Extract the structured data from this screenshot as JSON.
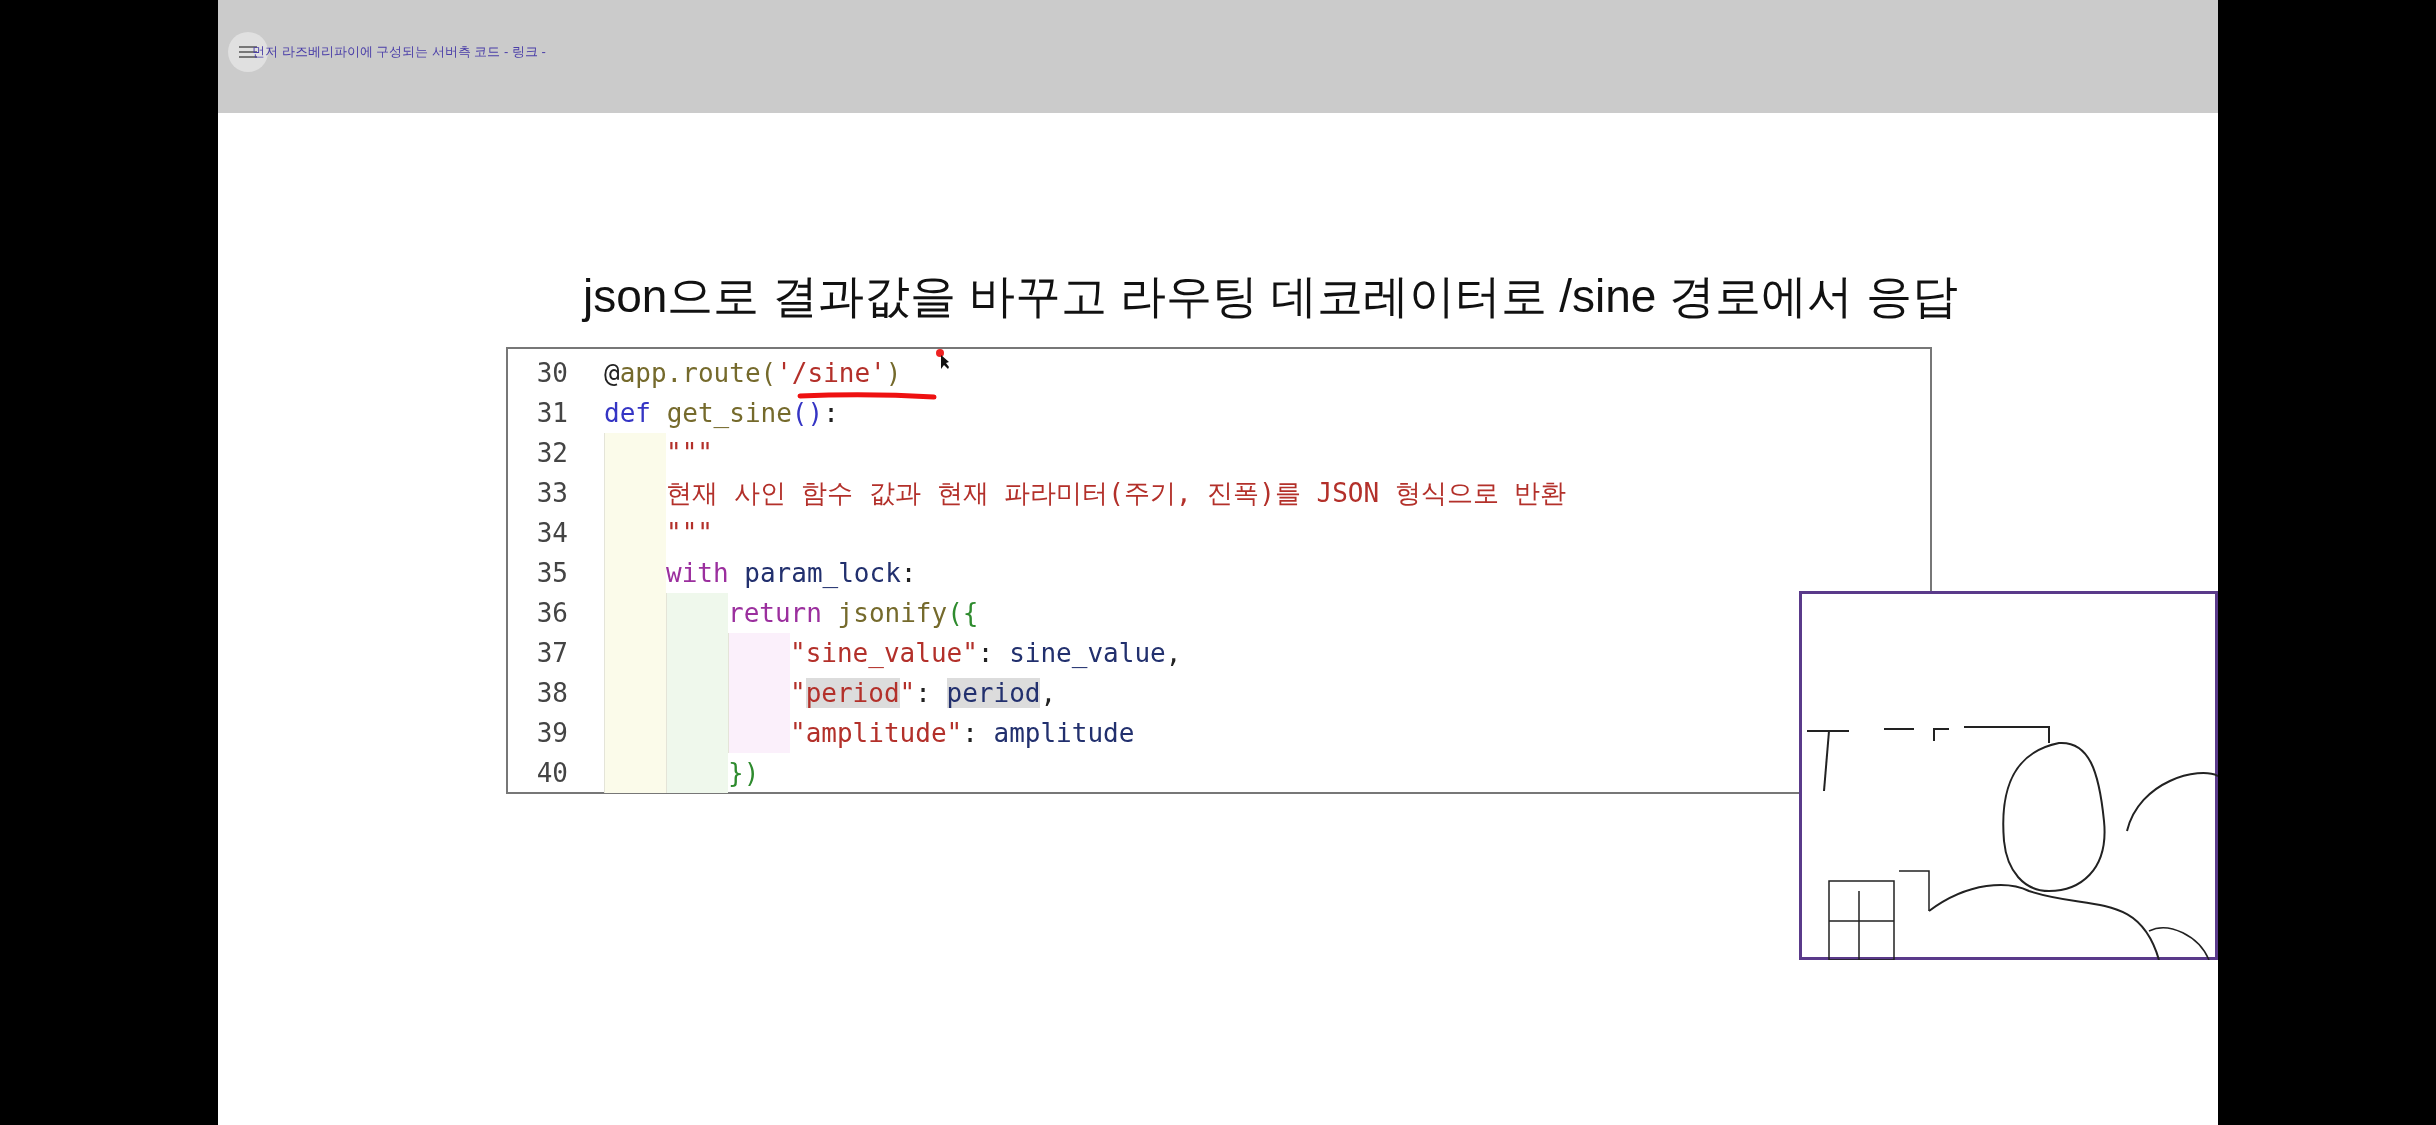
{
  "header": {
    "title": "먼저 라즈베리파이에 구성되는 서버측 코드 - 링크 -"
  },
  "slide": {
    "title": "json으로 결과값을 바꾸고 라우팅 데코레이터로 /sine 경로에서 응답",
    "code": [
      {
        "number": "30",
        "tokens": [
          {
            "kind": "punct",
            "text": "@"
          },
          {
            "kind": "func",
            "text": "app.route("
          },
          {
            "kind": "string",
            "text": "'/sine'"
          },
          {
            "kind": "func",
            "text": ")"
          }
        ]
      },
      {
        "number": "31",
        "tokens": [
          {
            "kind": "keyword",
            "text": "def "
          },
          {
            "kind": "func",
            "text": "get_sine"
          },
          {
            "kind": "bracket",
            "text": "()"
          },
          {
            "kind": "punct",
            "text": ":"
          }
        ]
      },
      {
        "number": "32",
        "guides": [
          {
            "color": "#fbfbea"
          }
        ],
        "tokens": [
          {
            "kind": "docstring",
            "text": "\"\"\""
          }
        ]
      },
      {
        "number": "33",
        "guides": [
          {
            "color": "#fbfbea"
          }
        ],
        "tokens": [
          {
            "kind": "docstring",
            "text": "현재 사인 함수 값과 현재 파라미터(주기, 진폭)를 JSON 형식으로 반환"
          }
        ]
      },
      {
        "number": "34",
        "guides": [
          {
            "color": "#fbfbea"
          }
        ],
        "tokens": [
          {
            "kind": "docstring",
            "text": "\"\"\""
          }
        ]
      },
      {
        "number": "35",
        "guides": [
          {
            "color": "#fbfbea"
          }
        ],
        "tokens": [
          {
            "kind": "control",
            "text": "with "
          },
          {
            "kind": "variable",
            "text": "param_lock"
          },
          {
            "kind": "punct",
            "text": ":"
          }
        ]
      },
      {
        "number": "36",
        "guides": [
          {
            "color": "#fbfbea"
          },
          {
            "color": "#eff8ec"
          }
        ],
        "tokens": [
          {
            "kind": "control",
            "text": "return "
          },
          {
            "kind": "func",
            "text": "jsonify"
          },
          {
            "kind": "bracket",
            "text": "({"
          }
        ]
      },
      {
        "number": "37",
        "guides": [
          {
            "color": "#fbfbea"
          },
          {
            "color": "#eff8ec"
          },
          {
            "color": "#fbf0fb"
          }
        ],
        "tokens": [
          {
            "kind": "string",
            "text": "\"sine_value\""
          },
          {
            "kind": "punct",
            "text": ": "
          },
          {
            "kind": "variable",
            "text": "sine_value"
          },
          {
            "kind": "punct",
            "text": ","
          }
        ]
      },
      {
        "number": "38",
        "guides": [
          {
            "color": "#fbfbea"
          },
          {
            "color": "#eff8ec"
          },
          {
            "color": "#fbf0fb"
          }
        ],
        "tokens": [
          {
            "kind": "string",
            "text": "\""
          },
          {
            "kind": "string",
            "text": "period",
            "highlighted": true
          },
          {
            "kind": "string",
            "text": "\""
          },
          {
            "kind": "punct",
            "text": ": "
          },
          {
            "kind": "variable",
            "text": "period",
            "highlighted": true
          },
          {
            "kind": "punct",
            "text": ","
          }
        ]
      },
      {
        "number": "39",
        "guides": [
          {
            "color": "#fbfbea"
          },
          {
            "color": "#eff8ec"
          },
          {
            "color": "#fbf0fb"
          }
        ],
        "tokens": [
          {
            "kind": "string",
            "text": "\"amplitude\""
          },
          {
            "kind": "punct",
            "text": ": "
          },
          {
            "kind": "variable",
            "text": "amplitude"
          }
        ]
      },
      {
        "number": "40",
        "guides": [
          {
            "color": "#fbfbea"
          },
          {
            "color": "#eff8ec"
          }
        ],
        "tokens": [
          {
            "kind": "bracket",
            "text": "})"
          }
        ]
      }
    ]
  }
}
